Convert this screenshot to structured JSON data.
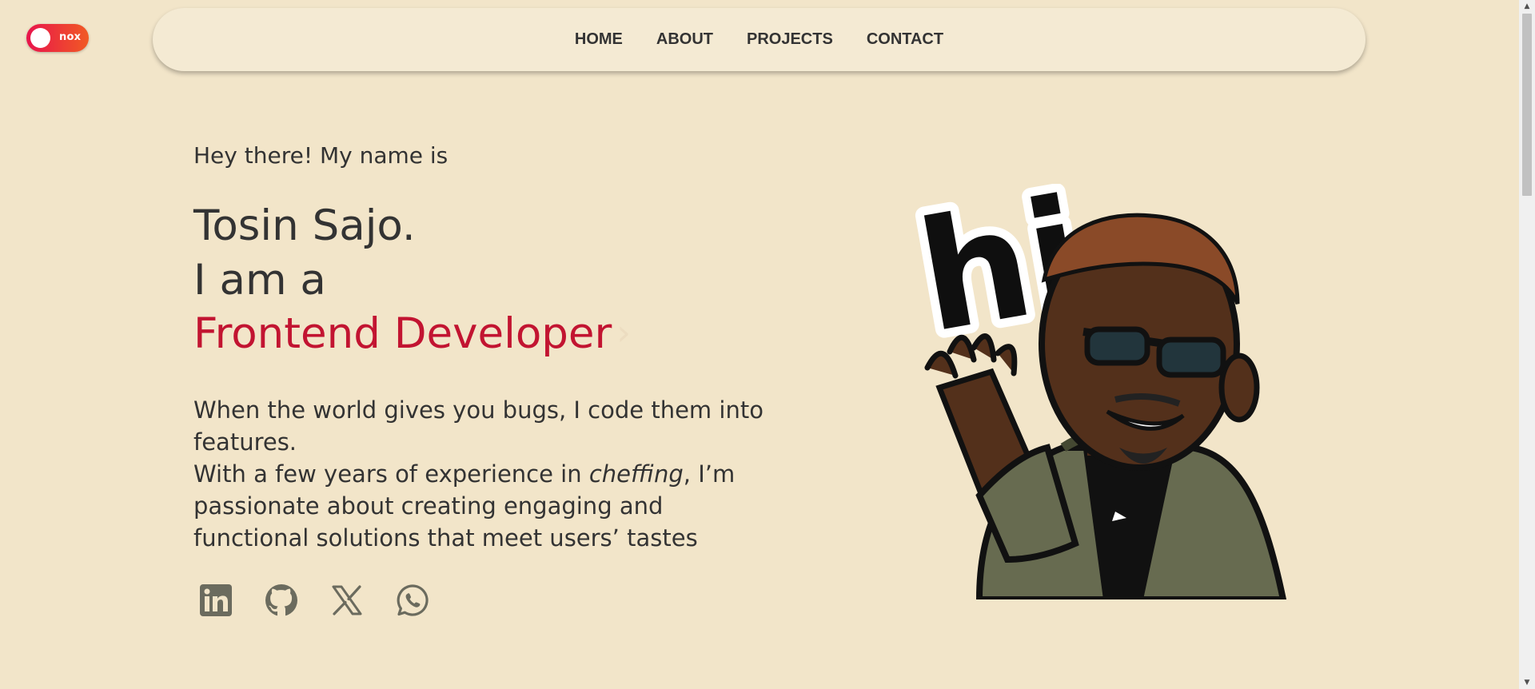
{
  "theme_toggle": {
    "label": "nox",
    "colors": {
      "start": "#e8144c",
      "end": "#f15a24"
    }
  },
  "nav": {
    "items": [
      "HOME",
      "ABOUT",
      "PROJECTS",
      "CONTACT"
    ]
  },
  "hero": {
    "intro": "Hey there! My name is",
    "name": "Tosin Sajo.",
    "i_am": "I am a",
    "role": "Frontend Developer",
    "role_chevron": "›",
    "desc_line1": "When the world gives you bugs, I code them into features.",
    "desc_line2_a": "With a few years of experience in ",
    "desc_line2_em": "cheffing",
    "desc_line2_b": ", I’m passionate about creating engaging and functional solutions that meet users’ tastes"
  },
  "socials": [
    {
      "name": "LinkedIn",
      "icon": "linkedin-icon"
    },
    {
      "name": "GitHub",
      "icon": "github-icon"
    },
    {
      "name": "X",
      "icon": "x-icon"
    },
    {
      "name": "WhatsApp",
      "icon": "whatsapp-icon"
    }
  ],
  "avatar": {
    "sticker_text": "hi"
  },
  "colors": {
    "background": "#f2e5c9",
    "navbar": "#f4ead3",
    "accent": "#c21431",
    "text": "#333333",
    "icon": "#6b6b5e"
  }
}
